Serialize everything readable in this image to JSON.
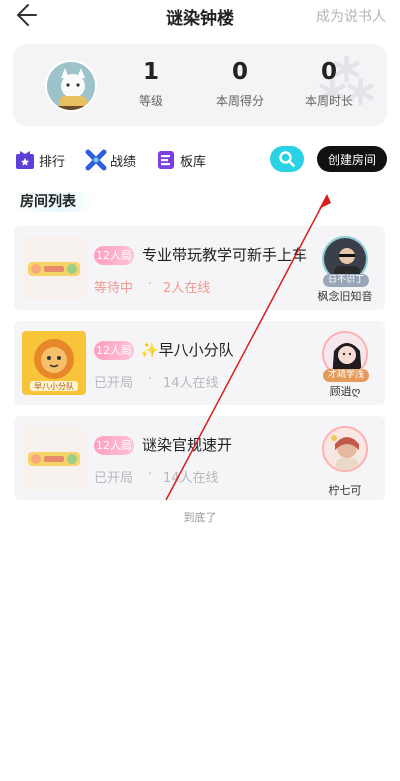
{
  "header": {
    "title": "谜染钟楼",
    "become_narrator": "成为说书人"
  },
  "stats": {
    "level": {
      "value": "1",
      "label": "等级"
    },
    "weekly_score": {
      "value": "0",
      "label": "本周得分"
    },
    "weekly_duration": {
      "value": "0",
      "label": "本周时长"
    }
  },
  "actions": {
    "ranking": "排行",
    "record": "战绩",
    "script_lib": "板库",
    "create_room": "创建房间"
  },
  "room_list": {
    "title": "房间列表",
    "rooms": [
      {
        "badge": "12人局",
        "name": "专业带玩教学可新手上车",
        "status": "等待中",
        "online": "2人在线",
        "host_name": "枫念旧知音",
        "host_tag": "日不识丁"
      },
      {
        "badge": "12人局",
        "name": "✨早八小分队",
        "status": "已开局",
        "online": "14人在线",
        "host_name": "顾逍ღ",
        "host_tag": "才疏学浅",
        "thumb_text": "早八小分队"
      },
      {
        "badge": "12人局",
        "name": "谜染官规速开",
        "status": "已开局",
        "online": "14人在线",
        "host_name": "柠七可"
      }
    ],
    "separator": "·",
    "end_text": "到底了"
  },
  "colors": {
    "accent_cyan": "#29d3e3",
    "badge_pink": "#ff9ec2",
    "waiting_red": "#f29a8f",
    "icon_purple": "#5b3fd6",
    "icon_blue": "#2f5fe0"
  }
}
